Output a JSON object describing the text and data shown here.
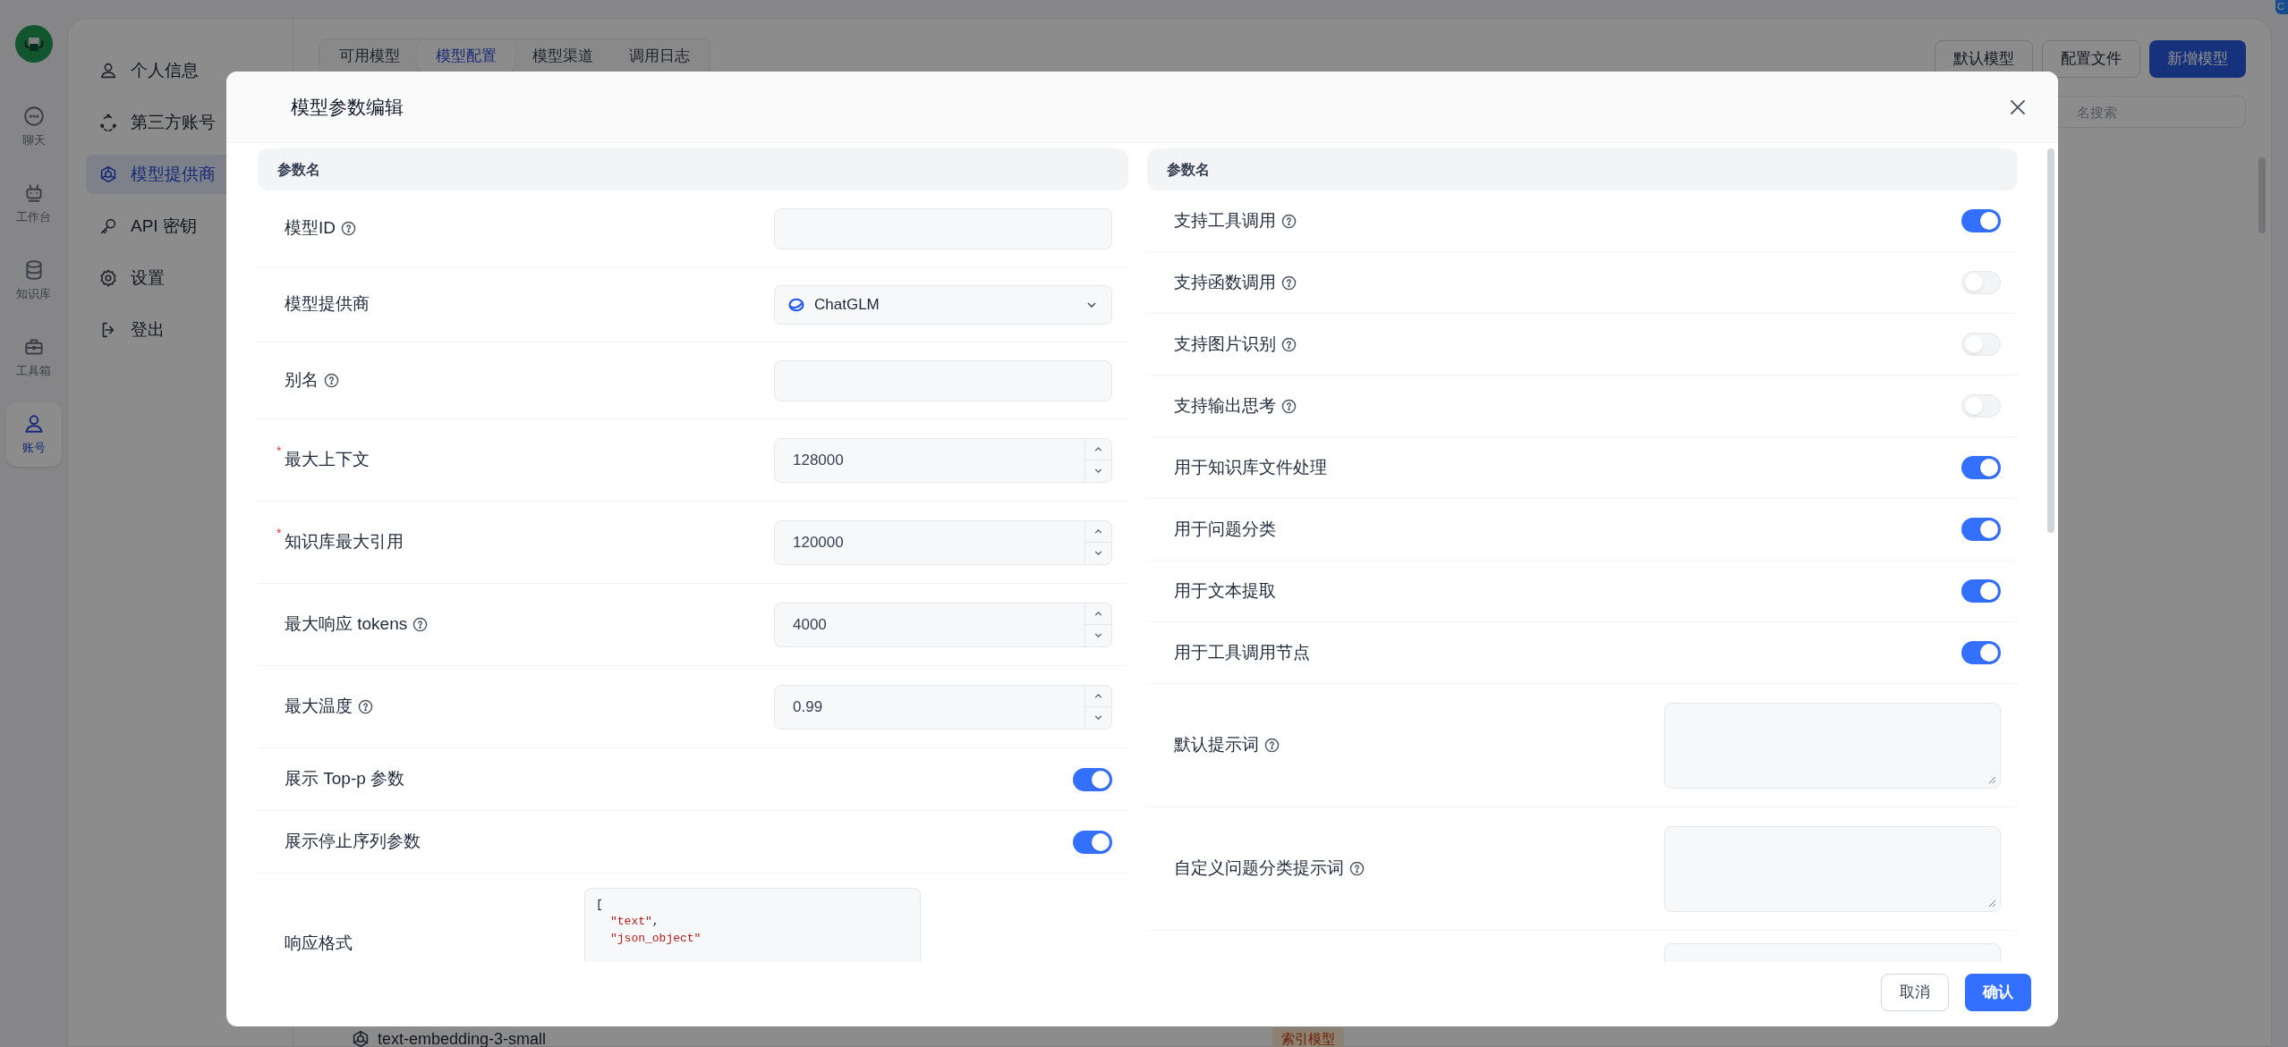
{
  "app_rail": [
    {
      "label": "聊天",
      "selected": false
    },
    {
      "label": "工作台",
      "selected": false
    },
    {
      "label": "知识库",
      "selected": false
    },
    {
      "label": "工具箱",
      "selected": false
    },
    {
      "label": "账号",
      "selected": true
    }
  ],
  "nav": [
    {
      "label": "个人信息",
      "selected": false
    },
    {
      "label": "第三方账号",
      "selected": false
    },
    {
      "label": "模型提供商",
      "selected": true
    },
    {
      "label": "API 密钥",
      "selected": false
    },
    {
      "label": "设置",
      "selected": false
    },
    {
      "label": "登出",
      "selected": false
    }
  ],
  "tabs": [
    {
      "label": "可用模型",
      "selected": false
    },
    {
      "label": "模型配置",
      "selected": true
    },
    {
      "label": "模型渠道",
      "selected": false
    },
    {
      "label": "调用日志",
      "selected": false
    }
  ],
  "toolbar_buttons": [
    {
      "label": "默认模型",
      "kind": "outline"
    },
    {
      "label": "配置文件",
      "kind": "outline"
    },
    {
      "label": "新增模型",
      "kind": "primary"
    }
  ],
  "search": {
    "placeholder": "名搜索"
  },
  "corner_badge": "C",
  "background_row": {
    "name": "text-embedding-3-small",
    "tag": "索引模型"
  },
  "dialog": {
    "title": "模型参数编辑",
    "left": {
      "header": "参数名",
      "rows": [
        {
          "kind": "text",
          "label": "模型ID",
          "help": true
        },
        {
          "kind": "select",
          "label": "模型提供商",
          "help": false,
          "value": "ChatGLM"
        },
        {
          "kind": "text",
          "label": "别名",
          "help": true
        },
        {
          "kind": "number",
          "label": "最大上下文",
          "help": false,
          "required_mark": "*",
          "value": "128000"
        },
        {
          "kind": "number",
          "label": "知识库最大引用",
          "help": false,
          "required_mark": "*",
          "value": "120000"
        },
        {
          "kind": "number",
          "label": "最大响应 tokens",
          "help": true,
          "value": "4000"
        },
        {
          "kind": "number",
          "label": "最大温度",
          "help": true,
          "value": "0.99"
        },
        {
          "kind": "switch",
          "label": "展示 Top-p 参数",
          "help": false,
          "on": true
        },
        {
          "kind": "switch",
          "label": "展示停止序列参数",
          "help": false,
          "on": true
        },
        {
          "kind": "code",
          "label": "响应格式",
          "help": false,
          "lines": [
            [
              {
                "text": "[",
                "kind": "punct"
              }
            ],
            [
              {
                "text": "\"text\"",
                "kind": "string"
              },
              {
                "text": ",",
                "kind": "punct"
              }
            ],
            [
              {
                "text": "\"json_object\"",
                "kind": "string"
              }
            ]
          ]
        }
      ]
    },
    "right": {
      "header": "参数名",
      "rows": [
        {
          "kind": "switch",
          "label": "支持工具调用",
          "help": true,
          "on": true
        },
        {
          "kind": "switch",
          "label": "支持函数调用",
          "help": true,
          "on": false
        },
        {
          "kind": "switch",
          "label": "支持图片识别",
          "help": true,
          "on": false
        },
        {
          "kind": "switch",
          "label": "支持输出思考",
          "help": true,
          "on": false
        },
        {
          "kind": "switch",
          "label": "用于知识库文件处理",
          "help": false,
          "on": true
        },
        {
          "kind": "switch",
          "label": "用于问题分类",
          "help": false,
          "on": true
        },
        {
          "kind": "switch",
          "label": "用于文本提取",
          "help": false,
          "on": true
        },
        {
          "kind": "switch",
          "label": "用于工具调用节点",
          "help": false,
          "on": true
        },
        {
          "kind": "textarea",
          "label": "默认提示词",
          "help": true
        },
        {
          "kind": "textarea",
          "label": "自定义问题分类提示词",
          "help": true
        },
        {
          "kind": "textarea_cut"
        }
      ]
    },
    "buttons": [
      {
        "label": "取消",
        "kind": "outline"
      },
      {
        "label": "确认",
        "kind": "primary"
      }
    ]
  }
}
